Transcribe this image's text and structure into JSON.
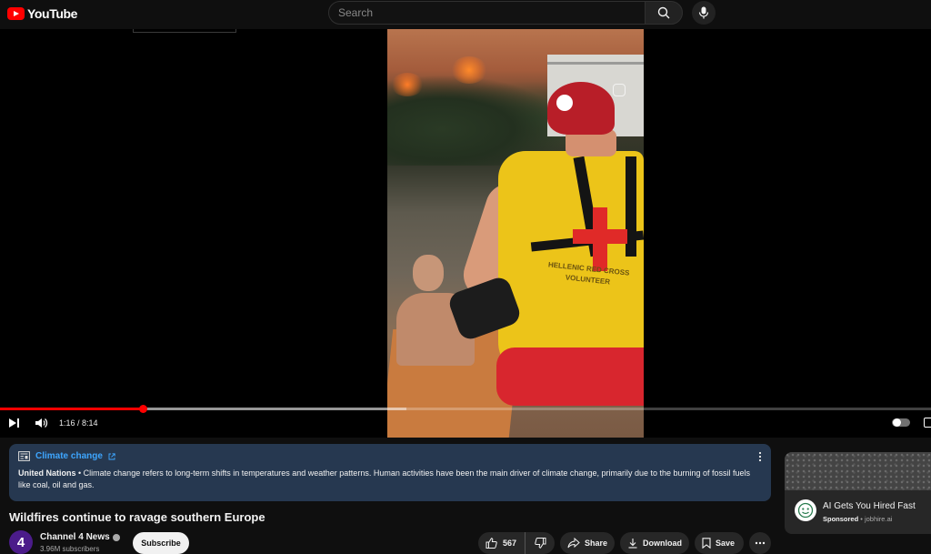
{
  "header": {
    "logo_text": "YouTube",
    "search_placeholder": "Search"
  },
  "player": {
    "current_time": "1:16",
    "duration": "8:14",
    "time_display": "1:16 / 8:14",
    "progress_fraction": 0.154,
    "buffer_fraction": 0.437,
    "vest_text": "HELLENIC RED CROSS VOLUNTEER",
    "accent_color": "#ff0000"
  },
  "info_panel": {
    "topic_link": "Climate change",
    "source": "United Nations",
    "description": " • Climate change refers to long-term shifts in temperatures and weather patterns. Human activities have been the main driver of climate change, primarily due to the burning of fossil fuels like coal, oil and gas.",
    "background_color": "#263850"
  },
  "video": {
    "title": "Wildfires continue to ravage southern Europe"
  },
  "channel": {
    "name": "Channel 4 News",
    "avatar_text": "4",
    "subscribers": "3.96M subscribers",
    "subscribe_label": "Subscribe"
  },
  "actions": {
    "like_count": "567",
    "share_label": "Share",
    "download_label": "Download",
    "save_label": "Save"
  },
  "ad": {
    "title": "AI Gets You Hired Fast",
    "sponsored_label": "Sponsored",
    "domain": " • jobhire.ai"
  }
}
